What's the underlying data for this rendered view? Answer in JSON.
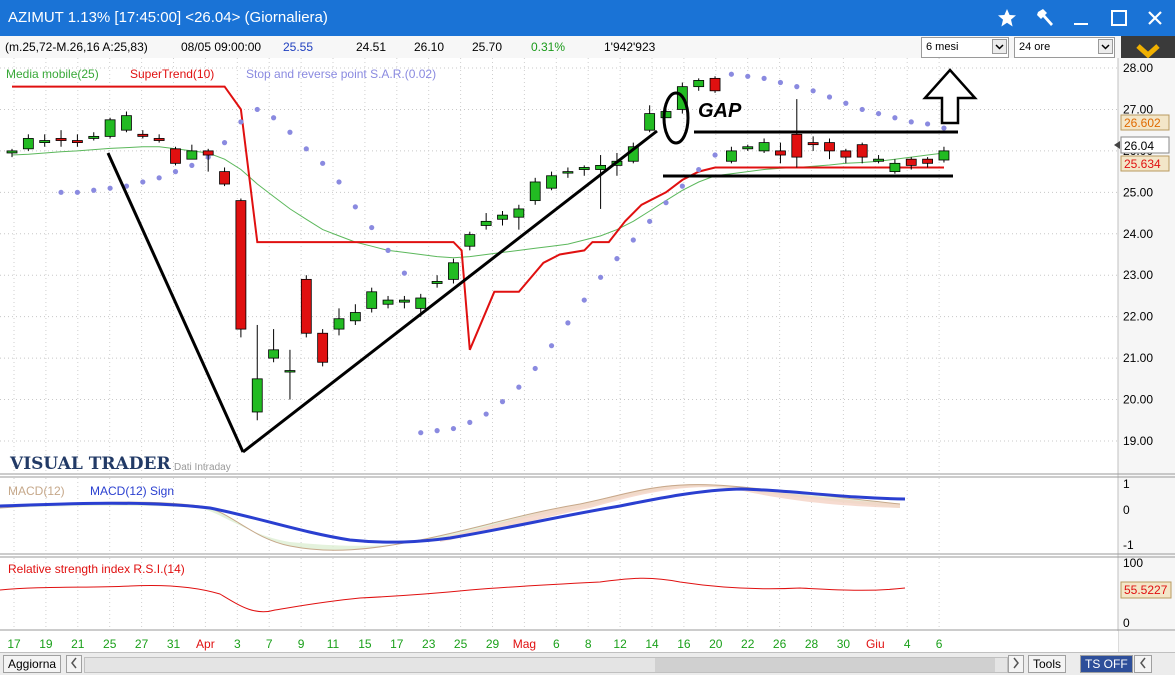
{
  "window": {
    "title": "AZIMUT 1.13% [17:45:00]  <26.04> (Giornaliera)",
    "colors": {
      "titlebar": "#1a73d6",
      "up": "#22bb22",
      "down": "#e01010",
      "supertrend": "#e01010",
      "ma": "#5cb85c",
      "sar": "#8a8ae0"
    }
  },
  "infobar": {
    "ma_info": "(m.25,72-M.26,16 A:25,83)",
    "datetime": "08/05 09:00:00",
    "last": "25.55",
    "low": "24.51",
    "high": "26.10",
    "open": "25.70",
    "change": "0.31%",
    "volume": "1'942'923",
    "period": "6 mesi",
    "interval": "24 ore"
  },
  "legend": {
    "ma": "Media mobile(25)",
    "supertrend": "SuperTrend(10)",
    "sar": "Stop and reverse point S.A.R.(0.02)"
  },
  "watermark": {
    "brand": "VISUAL TRADER",
    "sub": "Dati Intraday"
  },
  "annotation": {
    "gap": "GAP"
  },
  "price_badges": {
    "upper": "26.602",
    "last": "26.04",
    "lower": "25.634"
  },
  "price_axis": [
    "28.00",
    "27.00",
    "26.00",
    "25.00",
    "24.00",
    "23.00",
    "22.00",
    "21.00",
    "20.00",
    "19.00"
  ],
  "macd": {
    "label1": "MACD(12)",
    "label2": "MACD(12) Sign",
    "axis": [
      "1",
      "0",
      "-1"
    ]
  },
  "rsi": {
    "label": "Relative strength index R.S.I.(14)",
    "axis": [
      "100",
      "0"
    ],
    "badge": "55.5227"
  },
  "dates": [
    {
      "t": "17",
      "c": "green"
    },
    {
      "t": "19",
      "c": "green"
    },
    {
      "t": "21",
      "c": "green"
    },
    {
      "t": "25",
      "c": "green"
    },
    {
      "t": "27",
      "c": "green"
    },
    {
      "t": "31",
      "c": "green"
    },
    {
      "t": "Apr",
      "c": "red"
    },
    {
      "t": "3",
      "c": "green"
    },
    {
      "t": "7",
      "c": "green"
    },
    {
      "t": "9",
      "c": "green"
    },
    {
      "t": "11",
      "c": "green"
    },
    {
      "t": "15",
      "c": "green"
    },
    {
      "t": "17",
      "c": "green"
    },
    {
      "t": "23",
      "c": "green"
    },
    {
      "t": "25",
      "c": "green"
    },
    {
      "t": "29",
      "c": "green"
    },
    {
      "t": "Mag",
      "c": "red"
    },
    {
      "t": "6",
      "c": "green"
    },
    {
      "t": "8",
      "c": "green"
    },
    {
      "t": "12",
      "c": "green"
    },
    {
      "t": "14",
      "c": "green"
    },
    {
      "t": "16",
      "c": "green"
    },
    {
      "t": "20",
      "c": "green"
    },
    {
      "t": "22",
      "c": "green"
    },
    {
      "t": "26",
      "c": "green"
    },
    {
      "t": "28",
      "c": "green"
    },
    {
      "t": "30",
      "c": "green"
    },
    {
      "t": "Giu",
      "c": "red"
    },
    {
      "t": "4",
      "c": "green"
    },
    {
      "t": "6",
      "c": "green"
    }
  ],
  "bottom": {
    "refresh": "Aggiorna",
    "tools": "Tools",
    "ts": "TS OFF"
  },
  "chart_data": {
    "type": "candlestick",
    "candles": [
      [
        25.95,
        26.0,
        25.85,
        26.05
      ],
      [
        26.05,
        26.3,
        26.0,
        26.4
      ],
      [
        26.2,
        26.25,
        26.1,
        26.4
      ],
      [
        26.3,
        26.25,
        26.1,
        26.5
      ],
      [
        26.25,
        26.2,
        26.1,
        26.4
      ],
      [
        26.3,
        26.35,
        26.25,
        26.45
      ],
      [
        26.35,
        26.75,
        26.3,
        26.8
      ],
      [
        26.5,
        26.85,
        26.45,
        26.95
      ],
      [
        26.4,
        26.35,
        26.3,
        26.5
      ],
      [
        26.3,
        26.25,
        26.2,
        26.4
      ],
      [
        26.05,
        25.7,
        25.65,
        26.1
      ],
      [
        25.8,
        26.0,
        25.8,
        26.15
      ],
      [
        26.0,
        25.9,
        25.5,
        26.05
      ],
      [
        25.5,
        25.2,
        25.15,
        25.6
      ],
      [
        24.8,
        21.7,
        21.5,
        24.85
      ],
      [
        19.7,
        20.5,
        19.5,
        21.8
      ],
      [
        21.0,
        21.2,
        20.9,
        21.7
      ],
      [
        20.7,
        20.7,
        20.0,
        21.2
      ],
      [
        22.9,
        21.6,
        21.5,
        23.0
      ],
      [
        21.6,
        20.9,
        20.8,
        21.7
      ],
      [
        21.7,
        21.95,
        21.55,
        22.2
      ],
      [
        21.9,
        22.1,
        21.8,
        22.3
      ],
      [
        22.2,
        22.6,
        22.1,
        22.7
      ],
      [
        22.3,
        22.4,
        22.2,
        22.5
      ],
      [
        22.35,
        22.4,
        22.2,
        22.5
      ],
      [
        22.2,
        22.45,
        22.0,
        22.55
      ],
      [
        22.8,
        22.85,
        22.7,
        23.0
      ],
      [
        22.9,
        23.3,
        22.8,
        23.4
      ],
      [
        23.7,
        23.98,
        23.6,
        24.05
      ],
      [
        24.2,
        24.3,
        24.1,
        24.5
      ],
      [
        24.35,
        24.45,
        24.2,
        24.55
      ],
      [
        24.4,
        24.6,
        24.1,
        24.7
      ],
      [
        24.8,
        25.25,
        24.7,
        25.35
      ],
      [
        25.1,
        25.4,
        25.05,
        25.5
      ],
      [
        25.5,
        25.5,
        25.35,
        25.6
      ],
      [
        25.55,
        25.6,
        25.4,
        25.65
      ],
      [
        25.55,
        25.65,
        24.6,
        25.9
      ],
      [
        25.65,
        25.75,
        25.4,
        25.95
      ],
      [
        25.75,
        26.1,
        25.7,
        26.2
      ],
      [
        26.5,
        26.9,
        26.45,
        27.1
      ],
      [
        26.8,
        26.95,
        26.8,
        27.05
      ],
      [
        27.0,
        27.55,
        26.9,
        27.65
      ],
      [
        27.55,
        27.7,
        27.45,
        27.75
      ],
      [
        27.75,
        27.45,
        27.4,
        27.8
      ],
      [
        25.75,
        26.0,
        25.7,
        26.1
      ],
      [
        26.05,
        26.1,
        26.0,
        26.15
      ],
      [
        26.0,
        26.2,
        25.95,
        26.3
      ],
      [
        26.0,
        25.9,
        25.7,
        26.2
      ],
      [
        26.4,
        25.85,
        25.6,
        27.25
      ],
      [
        26.2,
        26.15,
        26.0,
        26.35
      ],
      [
        26.2,
        26.0,
        25.8,
        26.3
      ],
      [
        26.0,
        25.85,
        25.7,
        26.05
      ],
      [
        26.15,
        25.85,
        25.7,
        26.2
      ],
      [
        25.75,
        25.8,
        25.7,
        25.9
      ],
      [
        25.5,
        25.7,
        25.45,
        25.8
      ],
      [
        25.8,
        25.65,
        25.55,
        25.85
      ],
      [
        25.8,
        25.7,
        25.6,
        25.85
      ],
      [
        25.78,
        26.0,
        25.72,
        26.1
      ]
    ],
    "price_range": [
      18.5,
      28.3
    ]
  }
}
